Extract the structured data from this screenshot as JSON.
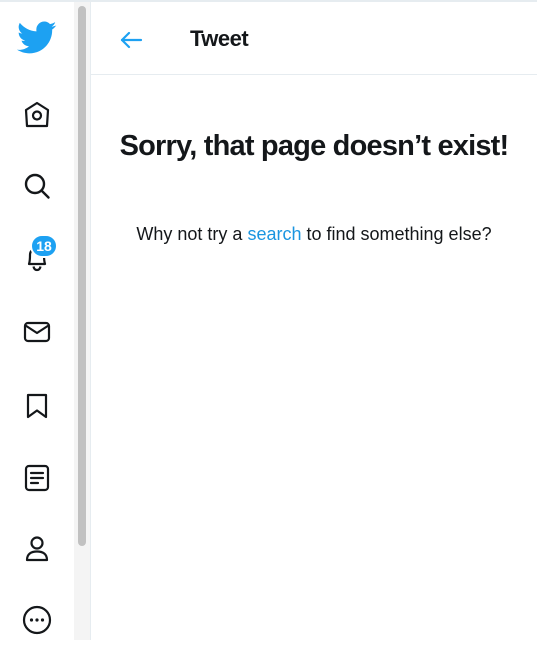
{
  "colors": {
    "brand": "#1da1f2",
    "link": "#1b95e0",
    "text": "#14171a",
    "border": "#e6ecf0"
  },
  "sidebar": {
    "items": [
      {
        "name": "twitter-logo",
        "icon": "bird-icon"
      },
      {
        "name": "home",
        "icon": "home-icon"
      },
      {
        "name": "explore",
        "icon": "search-icon"
      },
      {
        "name": "notifications",
        "icon": "bell-icon",
        "badge": "18"
      },
      {
        "name": "messages",
        "icon": "envelope-icon"
      },
      {
        "name": "bookmarks",
        "icon": "bookmark-icon"
      },
      {
        "name": "lists",
        "icon": "list-icon"
      },
      {
        "name": "profile",
        "icon": "person-icon"
      },
      {
        "name": "more",
        "icon": "more-icon"
      }
    ]
  },
  "header": {
    "back_icon": "arrow-left-icon",
    "title": "Tweet"
  },
  "error": {
    "title": "Sorry, that page doesn’t exist!",
    "text_before": "Why not try a ",
    "link_text": "search",
    "text_after": " to find something else?"
  }
}
